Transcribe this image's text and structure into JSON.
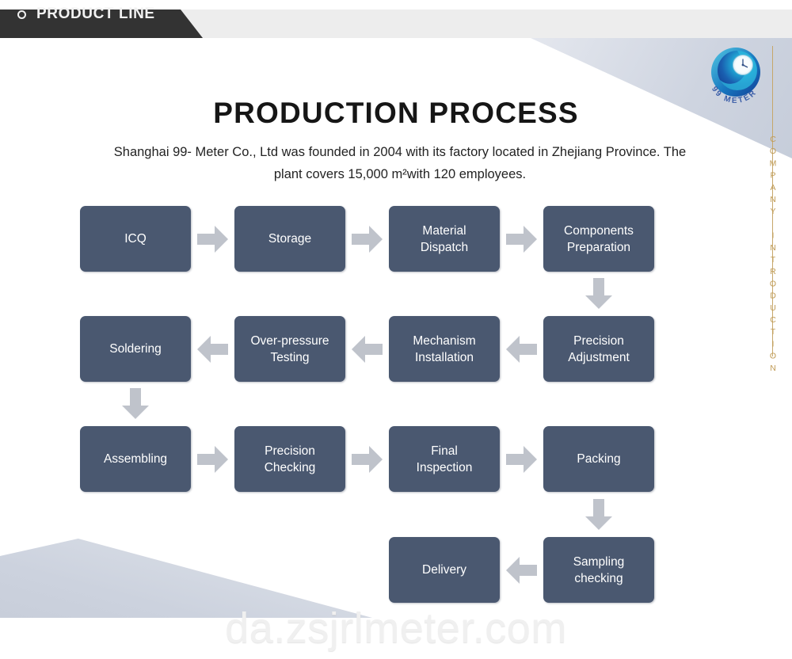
{
  "header": {
    "tab_label": "PRODUCT LINE",
    "icon": "circle-icon",
    "tab_color": "#333333",
    "bar_color": "#ededed"
  },
  "logo": {
    "name": "99-meter-logo",
    "brand_text": "99 METER",
    "accent_color": "#1f8fc4"
  },
  "side_label": {
    "text": "COMPANY INTRODUCTION",
    "color": "#c09b55"
  },
  "title": "PRODUCTION PROCESS",
  "subtitle": "Shanghai 99- Meter Co., Ltd was founded in 2004 with its factory located in Zhejiang Province. The plant covers 15,000 m²with 120 employees.",
  "flow": {
    "box_color": "#4a5870",
    "arrow_color": "#bfc3cb",
    "steps": [
      {
        "id": "icq",
        "label": "ICQ",
        "row": 1
      },
      {
        "id": "storage",
        "label": "Storage",
        "row": 1
      },
      {
        "id": "material-dispatch",
        "label": "Material\nDispatch",
        "row": 1
      },
      {
        "id": "components-preparation",
        "label": "Components\nPreparation",
        "row": 1
      },
      {
        "id": "precision-adjustment",
        "label": "Precision\nAdjustment",
        "row": 2
      },
      {
        "id": "mechanism-installation",
        "label": "Mechanism\nInstallation",
        "row": 2
      },
      {
        "id": "over-pressure-testing",
        "label": "Over-pressure\nTesting",
        "row": 2
      },
      {
        "id": "soldering",
        "label": "Soldering",
        "row": 2
      },
      {
        "id": "assembling",
        "label": "Assembling",
        "row": 3
      },
      {
        "id": "precision-checking",
        "label": "Precision\nChecking",
        "row": 3
      },
      {
        "id": "final-inspection",
        "label": "Final\nInspection",
        "row": 3
      },
      {
        "id": "packing",
        "label": "Packing",
        "row": 3
      },
      {
        "id": "sampling-checking",
        "label": "Sampling\nchecking",
        "row": 4
      },
      {
        "id": "delivery",
        "label": "Delivery",
        "row": 4
      }
    ],
    "arrows": [
      {
        "id": "icq-to-storage",
        "direction": "right"
      },
      {
        "id": "storage-to-material-dispatch",
        "direction": "right"
      },
      {
        "id": "material-dispatch-to-components-preparation",
        "direction": "right"
      },
      {
        "id": "components-preparation-to-precision-adjustment",
        "direction": "down"
      },
      {
        "id": "precision-adjustment-to-mechanism-installation",
        "direction": "left"
      },
      {
        "id": "mechanism-installation-to-over-pressure-testing",
        "direction": "left"
      },
      {
        "id": "over-pressure-testing-to-soldering",
        "direction": "left"
      },
      {
        "id": "soldering-to-assembling",
        "direction": "down"
      },
      {
        "id": "assembling-to-precision-checking",
        "direction": "right"
      },
      {
        "id": "precision-checking-to-final-inspection",
        "direction": "right"
      },
      {
        "id": "final-inspection-to-packing",
        "direction": "right"
      },
      {
        "id": "packing-to-sampling-checking",
        "direction": "down"
      },
      {
        "id": "sampling-checking-to-delivery",
        "direction": "left"
      }
    ]
  },
  "watermark": "da.zsjrlmeter.com"
}
